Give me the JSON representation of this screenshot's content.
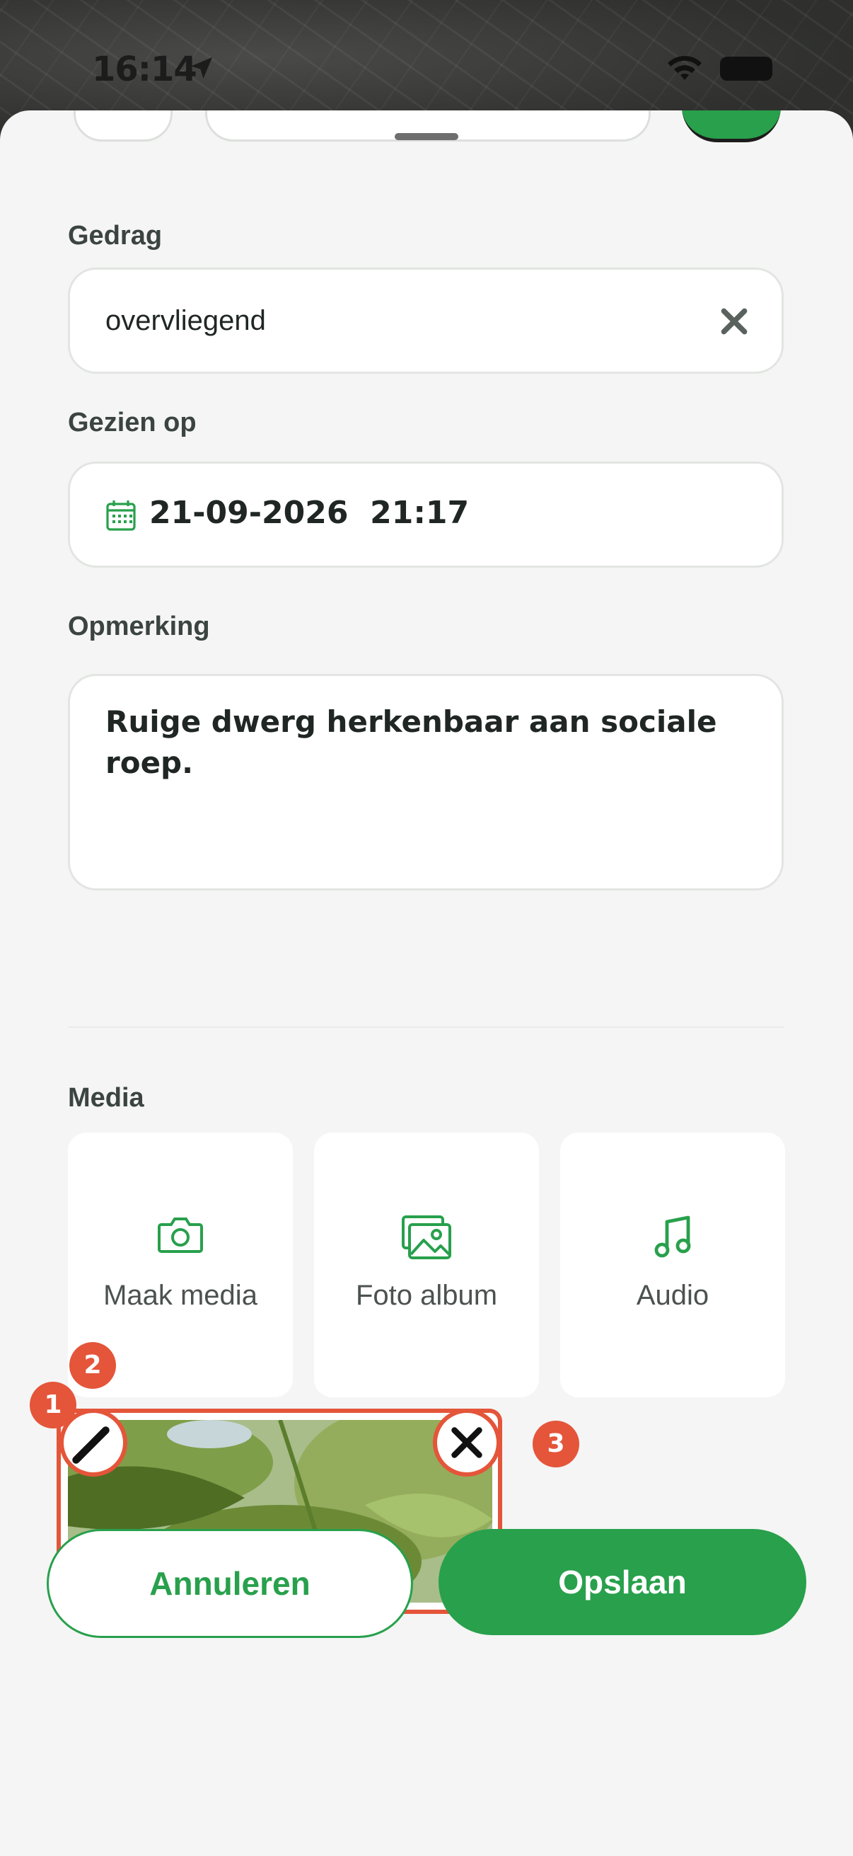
{
  "status_bar": {
    "time": "16:14"
  },
  "form": {
    "gedrag": {
      "label": "Gedrag",
      "value": "overvliegend"
    },
    "gezien_op": {
      "label": "Gezien op",
      "date": "21-09-2026",
      "time": "21:17"
    },
    "opmerking": {
      "label": "Opmerking",
      "value": "Ruige dwerg herkenbaar aan sociale roep."
    }
  },
  "media": {
    "label": "Media",
    "options": [
      {
        "label": "Maak media",
        "icon": "camera-icon"
      },
      {
        "label": "Foto album",
        "icon": "photo-album-icon"
      },
      {
        "label": "Audio",
        "icon": "music-note-icon"
      }
    ],
    "badges": [
      "1",
      "2",
      "3"
    ]
  },
  "actions": {
    "cancel": "Annuleren",
    "save": "Opslaan"
  },
  "colors": {
    "accent": "#28a04c",
    "highlight": "#e4553a",
    "sheet_bg": "#f4f5f4"
  }
}
